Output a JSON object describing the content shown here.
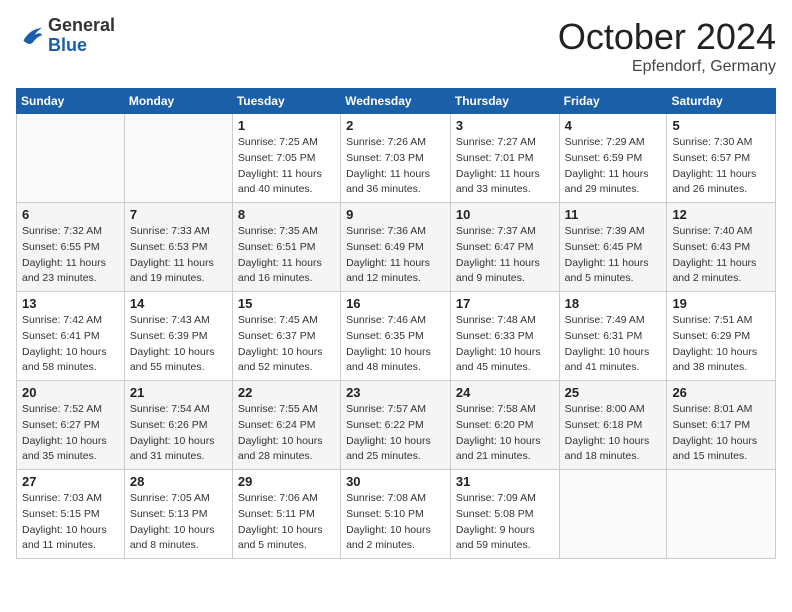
{
  "header": {
    "logo_general": "General",
    "logo_blue": "Blue",
    "month": "October 2024",
    "location": "Epfendorf, Germany"
  },
  "weekdays": [
    "Sunday",
    "Monday",
    "Tuesday",
    "Wednesday",
    "Thursday",
    "Friday",
    "Saturday"
  ],
  "weeks": [
    [
      {
        "day": "",
        "info": ""
      },
      {
        "day": "",
        "info": ""
      },
      {
        "day": "1",
        "info": "Sunrise: 7:25 AM\nSunset: 7:05 PM\nDaylight: 11 hours and 40 minutes."
      },
      {
        "day": "2",
        "info": "Sunrise: 7:26 AM\nSunset: 7:03 PM\nDaylight: 11 hours and 36 minutes."
      },
      {
        "day": "3",
        "info": "Sunrise: 7:27 AM\nSunset: 7:01 PM\nDaylight: 11 hours and 33 minutes."
      },
      {
        "day": "4",
        "info": "Sunrise: 7:29 AM\nSunset: 6:59 PM\nDaylight: 11 hours and 29 minutes."
      },
      {
        "day": "5",
        "info": "Sunrise: 7:30 AM\nSunset: 6:57 PM\nDaylight: 11 hours and 26 minutes."
      }
    ],
    [
      {
        "day": "6",
        "info": "Sunrise: 7:32 AM\nSunset: 6:55 PM\nDaylight: 11 hours and 23 minutes."
      },
      {
        "day": "7",
        "info": "Sunrise: 7:33 AM\nSunset: 6:53 PM\nDaylight: 11 hours and 19 minutes."
      },
      {
        "day": "8",
        "info": "Sunrise: 7:35 AM\nSunset: 6:51 PM\nDaylight: 11 hours and 16 minutes."
      },
      {
        "day": "9",
        "info": "Sunrise: 7:36 AM\nSunset: 6:49 PM\nDaylight: 11 hours and 12 minutes."
      },
      {
        "day": "10",
        "info": "Sunrise: 7:37 AM\nSunset: 6:47 PM\nDaylight: 11 hours and 9 minutes."
      },
      {
        "day": "11",
        "info": "Sunrise: 7:39 AM\nSunset: 6:45 PM\nDaylight: 11 hours and 5 minutes."
      },
      {
        "day": "12",
        "info": "Sunrise: 7:40 AM\nSunset: 6:43 PM\nDaylight: 11 hours and 2 minutes."
      }
    ],
    [
      {
        "day": "13",
        "info": "Sunrise: 7:42 AM\nSunset: 6:41 PM\nDaylight: 10 hours and 58 minutes."
      },
      {
        "day": "14",
        "info": "Sunrise: 7:43 AM\nSunset: 6:39 PM\nDaylight: 10 hours and 55 minutes."
      },
      {
        "day": "15",
        "info": "Sunrise: 7:45 AM\nSunset: 6:37 PM\nDaylight: 10 hours and 52 minutes."
      },
      {
        "day": "16",
        "info": "Sunrise: 7:46 AM\nSunset: 6:35 PM\nDaylight: 10 hours and 48 minutes."
      },
      {
        "day": "17",
        "info": "Sunrise: 7:48 AM\nSunset: 6:33 PM\nDaylight: 10 hours and 45 minutes."
      },
      {
        "day": "18",
        "info": "Sunrise: 7:49 AM\nSunset: 6:31 PM\nDaylight: 10 hours and 41 minutes."
      },
      {
        "day": "19",
        "info": "Sunrise: 7:51 AM\nSunset: 6:29 PM\nDaylight: 10 hours and 38 minutes."
      }
    ],
    [
      {
        "day": "20",
        "info": "Sunrise: 7:52 AM\nSunset: 6:27 PM\nDaylight: 10 hours and 35 minutes."
      },
      {
        "day": "21",
        "info": "Sunrise: 7:54 AM\nSunset: 6:26 PM\nDaylight: 10 hours and 31 minutes."
      },
      {
        "day": "22",
        "info": "Sunrise: 7:55 AM\nSunset: 6:24 PM\nDaylight: 10 hours and 28 minutes."
      },
      {
        "day": "23",
        "info": "Sunrise: 7:57 AM\nSunset: 6:22 PM\nDaylight: 10 hours and 25 minutes."
      },
      {
        "day": "24",
        "info": "Sunrise: 7:58 AM\nSunset: 6:20 PM\nDaylight: 10 hours and 21 minutes."
      },
      {
        "day": "25",
        "info": "Sunrise: 8:00 AM\nSunset: 6:18 PM\nDaylight: 10 hours and 18 minutes."
      },
      {
        "day": "26",
        "info": "Sunrise: 8:01 AM\nSunset: 6:17 PM\nDaylight: 10 hours and 15 minutes."
      }
    ],
    [
      {
        "day": "27",
        "info": "Sunrise: 7:03 AM\nSunset: 5:15 PM\nDaylight: 10 hours and 11 minutes."
      },
      {
        "day": "28",
        "info": "Sunrise: 7:05 AM\nSunset: 5:13 PM\nDaylight: 10 hours and 8 minutes."
      },
      {
        "day": "29",
        "info": "Sunrise: 7:06 AM\nSunset: 5:11 PM\nDaylight: 10 hours and 5 minutes."
      },
      {
        "day": "30",
        "info": "Sunrise: 7:08 AM\nSunset: 5:10 PM\nDaylight: 10 hours and 2 minutes."
      },
      {
        "day": "31",
        "info": "Sunrise: 7:09 AM\nSunset: 5:08 PM\nDaylight: 9 hours and 59 minutes."
      },
      {
        "day": "",
        "info": ""
      },
      {
        "day": "",
        "info": ""
      }
    ]
  ]
}
